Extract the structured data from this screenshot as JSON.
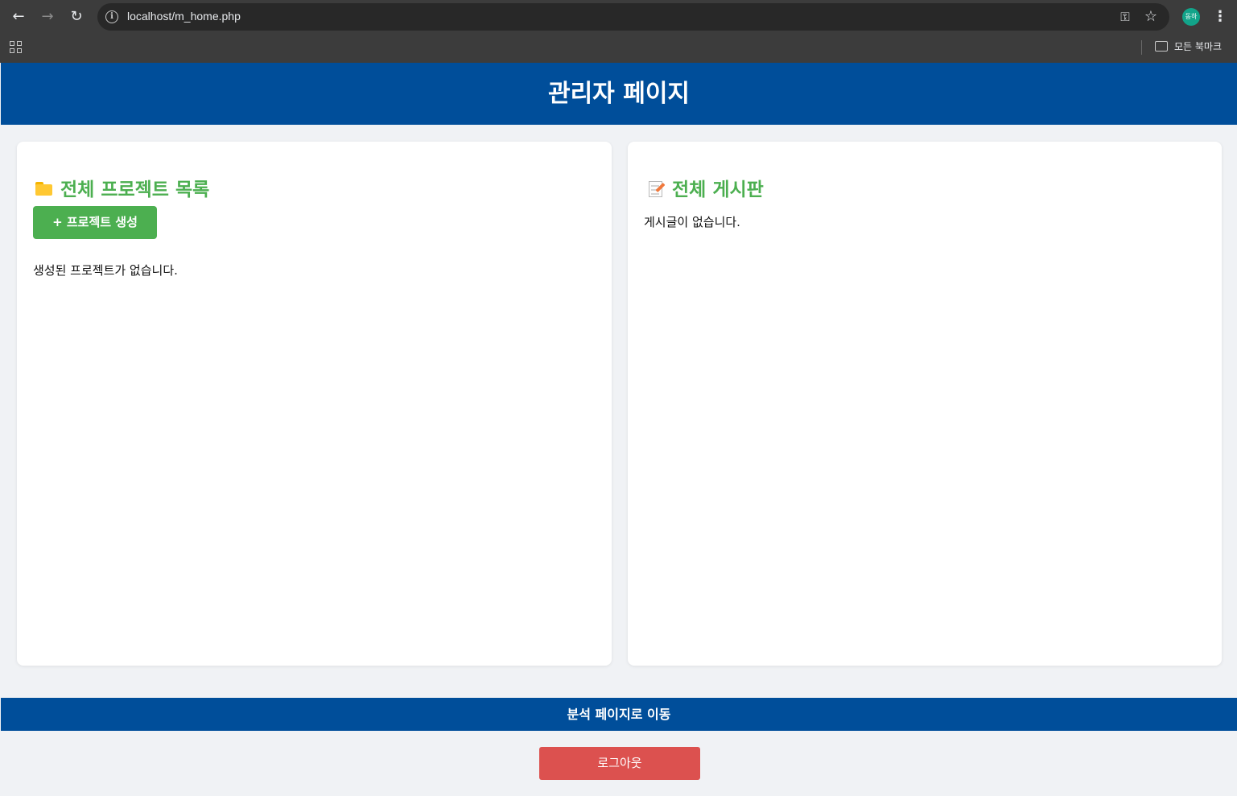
{
  "browser": {
    "url": "localhost/m_home.php",
    "profile_initials": "동하",
    "bookmarks_label": "모든 북마크"
  },
  "header": {
    "title": "관리자 페이지"
  },
  "projects": {
    "title": "전체 프로젝트 목록",
    "create_label": "+ 프로젝트 생성",
    "empty_text": "생성된 프로젝트가 없습니다."
  },
  "board": {
    "title": "전체 게시판",
    "empty_text": "게시글이 없습니다."
  },
  "footer": {
    "analysis_label": "분석 페이지로 이동",
    "logout_label": "로그아웃"
  },
  "colors": {
    "header_blue": "#004e9a",
    "accent_green": "#4caf50",
    "logout_red": "#dc514f",
    "background": "#f0f2f5"
  }
}
